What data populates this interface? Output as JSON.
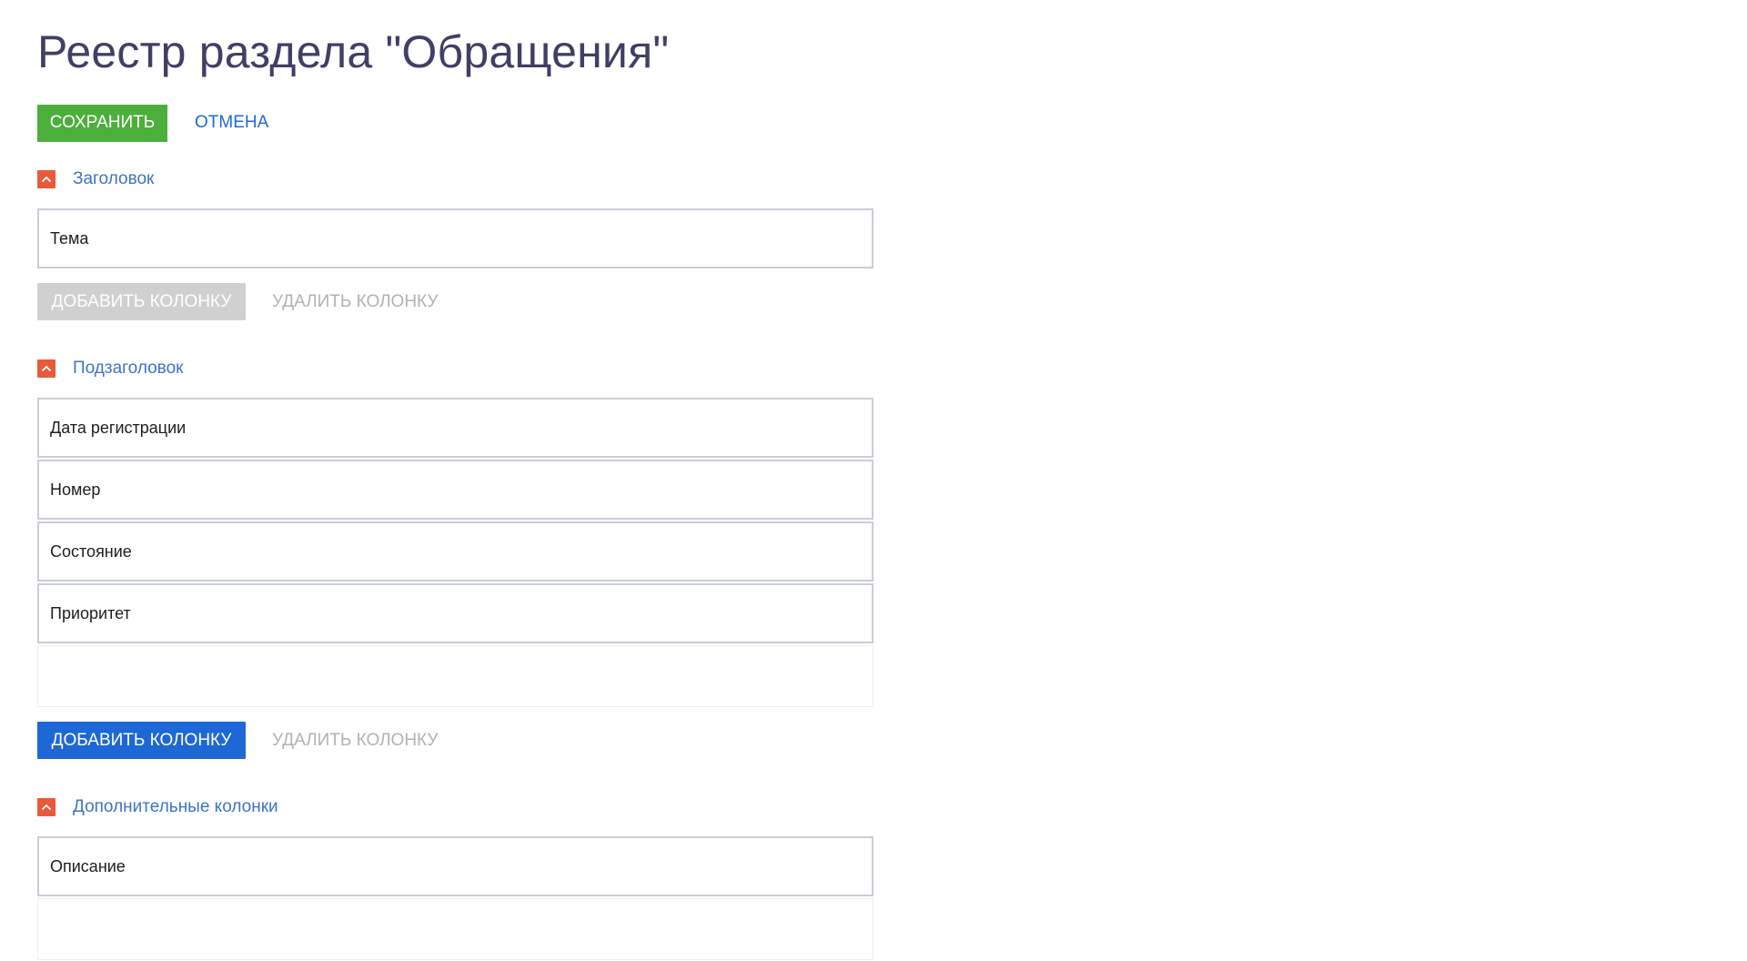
{
  "page": {
    "title": "Реестр раздела \"Обращения\""
  },
  "toolbar": {
    "save_label": "СОХРАНИТЬ",
    "cancel_label": "ОТМЕНА"
  },
  "groups": {
    "header": {
      "title": "Заголовок",
      "columns": [
        "Тема"
      ],
      "add_label": "ДОБАВИТЬ КОЛОНКУ",
      "remove_label": "УДАЛИТЬ КОЛОНКУ",
      "add_enabled": false
    },
    "subheader": {
      "title": "Подзаголовок",
      "columns": [
        "Дата регистрации",
        "Номер",
        "Состояние",
        "Приоритет"
      ],
      "add_label": "ДОБАВИТЬ КОЛОНКУ",
      "remove_label": "УДАЛИТЬ КОЛОНКУ",
      "add_enabled": true
    },
    "additional": {
      "title": "Дополнительные колонки",
      "columns": [
        "Описание"
      ]
    }
  },
  "colors": {
    "save_button": "#4caf3c",
    "primary_button": "#1e67d6",
    "disabled_button": "#d0d0d0",
    "collapse_icon": "#e85a3b",
    "link": "#1d6ccf",
    "title": "#403f66"
  },
  "icons": {
    "collapse": "chevron-up-icon"
  }
}
